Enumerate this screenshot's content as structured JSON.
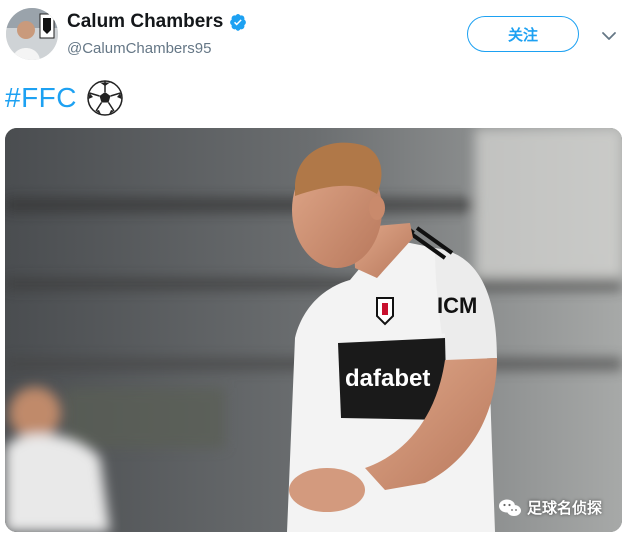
{
  "profile": {
    "display_name": "Calum Chambers",
    "handle": "@CalumChambers95",
    "verified": true
  },
  "follow_button": {
    "label": "关注"
  },
  "tweet": {
    "hashtag": "#FFC",
    "emoji": "soccer-ball-icon"
  },
  "media": {
    "jersey_sponsor": "dafabet",
    "sleeve_sponsor": "ICM",
    "watermark": "足球名侦探"
  },
  "colors": {
    "accent": "#1da1f2",
    "handle": "#657786",
    "name": "#14171a"
  }
}
